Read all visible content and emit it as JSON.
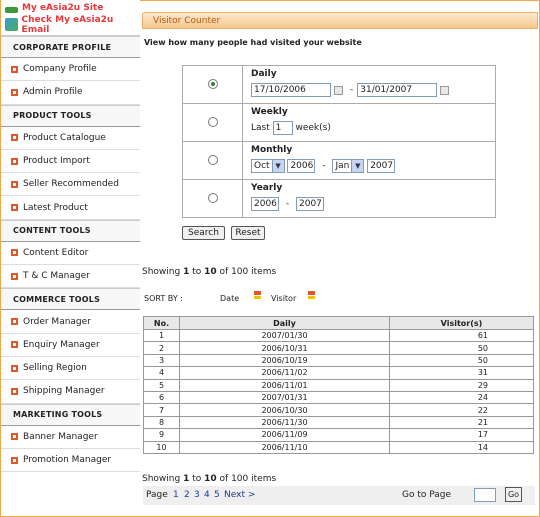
{
  "sidebar": {
    "top_links": [
      {
        "label": "My eAsia2u Site",
        "icon": "site-icon"
      },
      {
        "label": "Check My eAsia2u Email",
        "icon": "email-icon"
      }
    ],
    "sections": [
      {
        "title": "CORPORATE PROFILE",
        "items": [
          "Company Profile",
          "Admin Profile"
        ]
      },
      {
        "title": "PRODUCT TOOLS",
        "items": [
          "Product Catalogue",
          "Product Import",
          "Seller Recommended",
          "Latest Product"
        ]
      },
      {
        "title": "CONTENT TOOLS",
        "items": [
          "Content Editor",
          "T & C Manager"
        ]
      },
      {
        "title": "COMMERCE TOOLS",
        "items": [
          "Order Manager",
          "Enquiry Manager",
          "Selling Region",
          "Shipping Manager"
        ]
      },
      {
        "title": "MARKETING TOOLS",
        "items": [
          "Banner Manager",
          "Promotion Manager"
        ]
      }
    ]
  },
  "main": {
    "title": "Visitor Counter",
    "subtitle": "View how many people had visited your website",
    "filter": {
      "daily": {
        "label": "Daily",
        "from": "17/10/2006",
        "to": "31/01/2007",
        "selected": true
      },
      "weekly": {
        "label": "Weekly",
        "prefix": "Last",
        "value": "1",
        "suffix": "week(s)"
      },
      "monthly": {
        "label": "Monthly",
        "from_month": "Oct",
        "from_year": "2006",
        "to_month": "Jan",
        "to_year": "2007"
      },
      "yearly": {
        "label": "Yearly",
        "from": "2006",
        "to": "2007"
      },
      "dash": "-"
    },
    "buttons": {
      "search": "Search",
      "reset": "Reset"
    },
    "showing": {
      "prefix": "Showing",
      "from": "1",
      "to_word": "to",
      "to": "10",
      "of_word": "of 100 items"
    },
    "sort": {
      "label": "SORT BY :",
      "date": "Date",
      "visitor": "Visitor"
    },
    "table": {
      "headers": [
        "No.",
        "Daily",
        "Visitor(s)"
      ],
      "rows": [
        [
          "1",
          "2007/01/30",
          "61"
        ],
        [
          "2",
          "2006/10/31",
          "50"
        ],
        [
          "3",
          "2006/10/19",
          "50"
        ],
        [
          "4",
          "2006/11/02",
          "31"
        ],
        [
          "5",
          "2006/11/01",
          "29"
        ],
        [
          "6",
          "2007/01/31",
          "24"
        ],
        [
          "7",
          "2006/10/30",
          "22"
        ],
        [
          "8",
          "2006/11/30",
          "21"
        ],
        [
          "9",
          "2006/11/09",
          "17"
        ],
        [
          "10",
          "2006/11/10",
          "14"
        ]
      ]
    },
    "pager": {
      "label": "Page",
      "pages": [
        "1",
        "2",
        "3",
        "4",
        "5"
      ],
      "next": "Next >",
      "goto": "Go to Page",
      "go": "Go"
    }
  }
}
